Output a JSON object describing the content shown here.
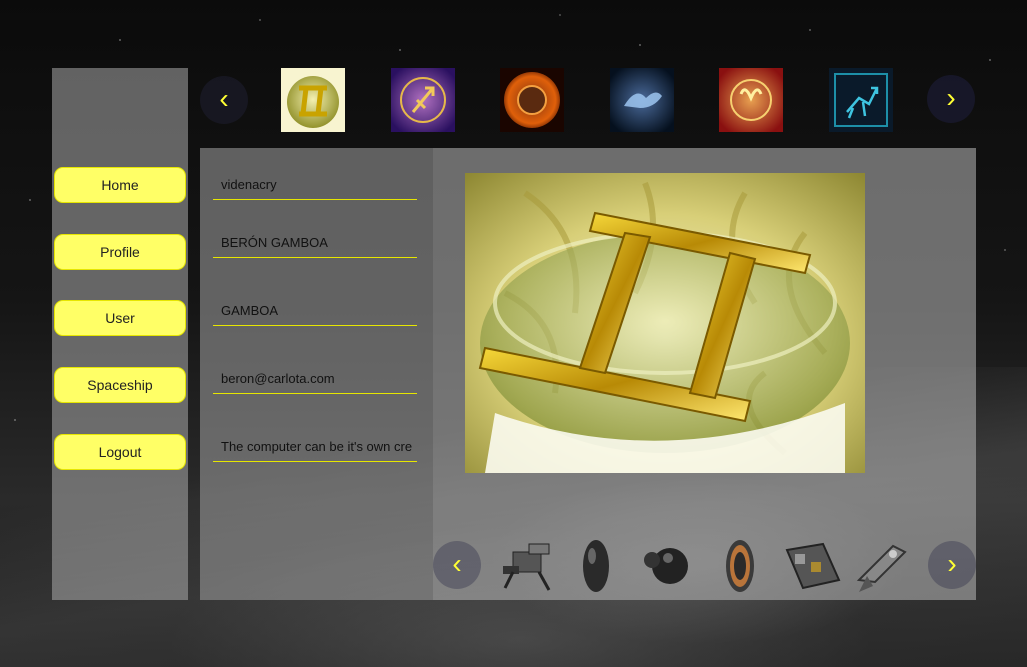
{
  "sidebar": {
    "items": [
      {
        "label": "Home"
      },
      {
        "label": "Profile"
      },
      {
        "label": "User"
      },
      {
        "label": "Spaceship"
      },
      {
        "label": "Logout"
      }
    ]
  },
  "zodiac_carousel": {
    "prev_icon": "‹",
    "next_icon": "›",
    "items": [
      {
        "icon": "gemini-icon"
      },
      {
        "icon": "sagittarius-icon"
      },
      {
        "icon": "leo-icon"
      },
      {
        "icon": "capricorn-icon"
      },
      {
        "icon": "aries-icon"
      },
      {
        "icon": "sagittarius-blue-icon"
      }
    ]
  },
  "profile_form": {
    "username": "videnacry",
    "full_name": "BERÓN GAMBOA",
    "last_name": "GAMBOA",
    "email": "beron@carlota.com",
    "bio": "The computer can be it's own cre"
  },
  "preview": {
    "icon": "gemini-sign-image"
  },
  "spaceship_carousel": {
    "prev_icon": "‹",
    "next_icon": "›",
    "items": [
      {
        "icon": "rover-ship-icon"
      },
      {
        "icon": "pod-ship-icon"
      },
      {
        "icon": "orb-ship-icon"
      },
      {
        "icon": "ring-ship-icon"
      },
      {
        "icon": "cargo-ship-icon"
      },
      {
        "icon": "fighter-ship-icon"
      }
    ]
  },
  "colors": {
    "accent": "#ffff66",
    "accent_border": "#e6e600",
    "arrow": "#ffff33"
  }
}
